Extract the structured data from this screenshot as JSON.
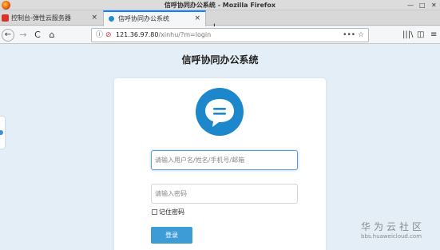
{
  "window": {
    "title": "信呼协同办公系统 - Mozilla Firefox"
  },
  "tabs": [
    {
      "label": "控制台-弹性云服务器",
      "close": "×"
    },
    {
      "label": "信呼协同办公系统",
      "close": "×"
    }
  ],
  "new_tab": "+",
  "nav": {
    "back": "←",
    "forward": "→",
    "reload": "C",
    "home": "⌂",
    "info": "ⓘ",
    "nosec": "🔓",
    "url_host": "121.36.97.80",
    "url_path": "/xinhu/?m=login",
    "page_actions": "•••  ☆",
    "library": "|||\\",
    "sidebar": "◫",
    "menu": "≡"
  },
  "page": {
    "title": "信呼协同办公系统",
    "username_placeholder": "请输入用户名/姓名/手机号/邮箱",
    "password_placeholder": "请输入密码",
    "remember_label": "记住密码",
    "login_button": "登录"
  },
  "watermark": {
    "cn": "华为云社区",
    "en": "bbs.huaweicloud.com"
  },
  "colors": {
    "accent": "#1d87cc",
    "button": "#3d9bd6",
    "background": "#e3eef6"
  }
}
